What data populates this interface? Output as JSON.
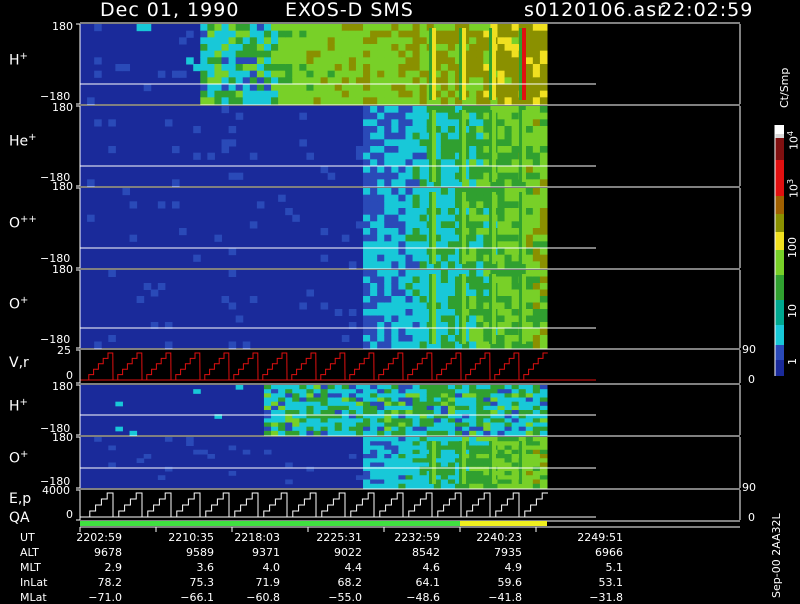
{
  "header": {
    "date": "Dec 01, 1990",
    "instrument": "EXOS-D SMS",
    "file": "s0120106.asr",
    "time": "22:02:59"
  },
  "panels": [
    {
      "label_base": "H",
      "label_sup": "+",
      "top_tick": "180",
      "bottom_tick": "−180"
    },
    {
      "label_base": "He",
      "label_sup": "+",
      "top_tick": "180",
      "bottom_tick": "−180"
    },
    {
      "label_base": "O",
      "label_sup": "++",
      "top_tick": "180",
      "bottom_tick": "−180"
    },
    {
      "label_base": "O",
      "label_sup": "+",
      "top_tick": "180",
      "bottom_tick": "−180"
    },
    {
      "label_base": "V,r",
      "label_sup": "",
      "top_tick": "25",
      "bottom_tick": "0",
      "right_top": "90",
      "right_bottom": "0"
    },
    {
      "label_base": "H",
      "label_sup": "+",
      "top_tick": "180",
      "bottom_tick": "−180"
    },
    {
      "label_base": "O",
      "label_sup": "+",
      "top_tick": "180",
      "bottom_tick": "−180"
    },
    {
      "label_base": "E,p",
      "label_sup": "",
      "top_tick": "4000",
      "bottom_tick": "0",
      "right_top": "90",
      "right_bottom": "0"
    }
  ],
  "qa_label": "QA",
  "colorbar": {
    "unit": "Ct/Smp",
    "tick_1": "1",
    "tick_10": "10",
    "tick_100": "100",
    "tick_1e3_base": "10",
    "tick_1e3_exp": "3",
    "tick_1e4_base": "10",
    "tick_1e4_exp": "4"
  },
  "ephemeris": {
    "row_labels": [
      "UT",
      "ALT",
      "MLT",
      "InLat",
      "MLat"
    ],
    "columns": [
      [
        "2202:59",
        "9678",
        "2.9",
        "78.2",
        "−71.0"
      ],
      [
        "2210:35",
        "9589",
        "3.6",
        "75.3",
        "−66.1"
      ],
      [
        "2218:03",
        "9371",
        "4.0",
        "71.9",
        "−60.8"
      ],
      [
        "2225:31",
        "9022",
        "4.4",
        "68.2",
        "−55.0"
      ],
      [
        "2232:59",
        "8542",
        "4.6",
        "64.1",
        "−48.6"
      ],
      [
        "2240:23",
        "7935",
        "4.9",
        "59.6",
        "−41.8"
      ],
      [
        "2249:51",
        "6966",
        "5.1",
        "53.1",
        "−31.8"
      ]
    ]
  },
  "footer": "Sep-00  2AA32L",
  "chart_data": {
    "type": "heatmap",
    "title": "Dec 01, 1990   EXOS-D SMS",
    "x": [
      "2202:59",
      "2210:35",
      "2218:03",
      "2225:31",
      "2232:59",
      "2240:23",
      "2249:51"
    ],
    "x_range": [
      "2202:59",
      "2249:51"
    ],
    "data_end_time": "2244:00",
    "y_panels": [
      {
        "name": "H+",
        "ylim": [
          -180,
          180
        ]
      },
      {
        "name": "He+",
        "ylim": [
          -180,
          180
        ]
      },
      {
        "name": "O++",
        "ylim": [
          -180,
          180
        ]
      },
      {
        "name": "O+",
        "ylim": [
          -180,
          180
        ]
      },
      {
        "name": "V,r",
        "ylim": [
          0,
          25
        ],
        "right_ylim": [
          0,
          90
        ]
      },
      {
        "name": "H+",
        "ylim": [
          -180,
          180
        ]
      },
      {
        "name": "O+",
        "ylim": [
          -180,
          180
        ]
      },
      {
        "name": "E,p",
        "ylim": [
          0,
          4000
        ],
        "right_ylim": [
          0,
          90
        ]
      }
    ],
    "color_scale": {
      "unit": "Ct/Smp",
      "log": true,
      "range": [
        1,
        10000
      ]
    },
    "colors": {
      "dark_blue": "#1a2a9a",
      "blue": "#2a4ab8",
      "cyan": "#18c8d8",
      "green": "#30a030",
      "light_green": "#78d028",
      "olive": "#8a9000",
      "yellow": "#f0e020",
      "red": "#e01010",
      "dark_red": "#801010",
      "white": "#ffffff"
    }
  }
}
